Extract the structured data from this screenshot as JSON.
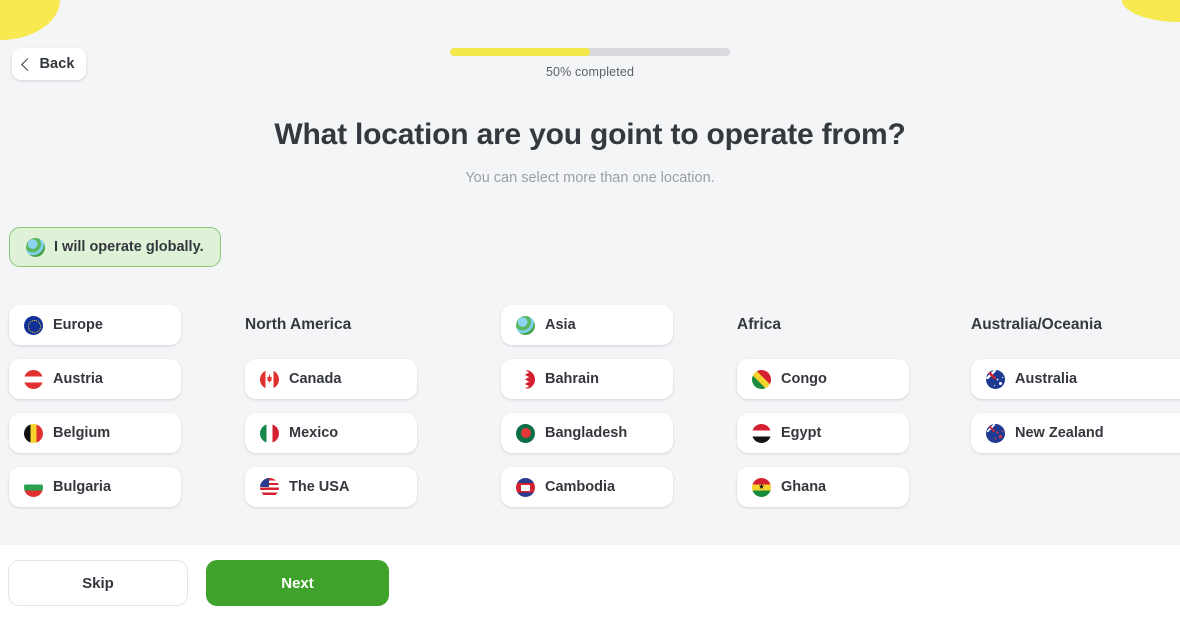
{
  "header": {
    "back_label": "Back",
    "progress_percent": 50,
    "progress_label": "50% completed",
    "progress_fill_color": "#f4e84a",
    "progress_track_color": "#d9dadd"
  },
  "page": {
    "title": "What location are you goint to operate from?",
    "subtitle": "You can select more than one location."
  },
  "global_option": {
    "label": "I will operate globally.",
    "icon": "globe-icon",
    "selected": true,
    "background_color": "#dff2d8",
    "border_color": "#8cc677"
  },
  "columns": [
    {
      "header": {
        "label": "Europe",
        "icon": "flag-eu-icon",
        "is_card": true,
        "flag_class": "f-eu"
      },
      "items": [
        {
          "label": "Austria",
          "icon": "flag-austria-icon",
          "flag_class": "f-at"
        },
        {
          "label": "Belgium",
          "icon": "flag-belgium-icon",
          "flag_class": "f-be"
        },
        {
          "label": "Bulgaria",
          "icon": "flag-bulgaria-icon",
          "flag_class": "f-bg"
        }
      ]
    },
    {
      "header": {
        "label": "North America",
        "icon": null,
        "is_card": false,
        "flag_class": ""
      },
      "items": [
        {
          "label": "Canada",
          "icon": "flag-canada-icon",
          "flag_class": "f-ca"
        },
        {
          "label": "Mexico",
          "icon": "flag-mexico-icon",
          "flag_class": "f-mx"
        },
        {
          "label": "The USA",
          "icon": "flag-usa-icon",
          "flag_class": "f-us"
        }
      ]
    },
    {
      "header": {
        "label": "Asia",
        "icon": "globe-icon",
        "is_card": true,
        "flag_class": "f-globe"
      },
      "items": [
        {
          "label": "Bahrain",
          "icon": "flag-bahrain-icon",
          "flag_class": "f-bh"
        },
        {
          "label": "Bangladesh",
          "icon": "flag-bangladesh-icon",
          "flag_class": "f-bd"
        },
        {
          "label": "Cambodia",
          "icon": "flag-cambodia-icon",
          "flag_class": "f-kh"
        }
      ]
    },
    {
      "header": {
        "label": "Africa",
        "icon": null,
        "is_card": false,
        "flag_class": ""
      },
      "items": [
        {
          "label": "Congo",
          "icon": "flag-congo-icon",
          "flag_class": "f-cg"
        },
        {
          "label": "Egypt",
          "icon": "flag-egypt-icon",
          "flag_class": "f-eg"
        },
        {
          "label": "Ghana",
          "icon": "flag-ghana-icon",
          "flag_class": "f-gh"
        }
      ]
    },
    {
      "header": {
        "label": "Australia/Oceania",
        "icon": null,
        "is_card": false,
        "flag_class": ""
      },
      "items": [
        {
          "label": "Australia",
          "icon": "flag-australia-icon",
          "flag_class": "f-au"
        },
        {
          "label": "New Zealand",
          "icon": "flag-new-zealand-icon",
          "flag_class": "f-nz"
        }
      ]
    }
  ],
  "footer": {
    "skip_label": "Skip",
    "next_label": "Next",
    "next_color": "#3fa22a"
  }
}
